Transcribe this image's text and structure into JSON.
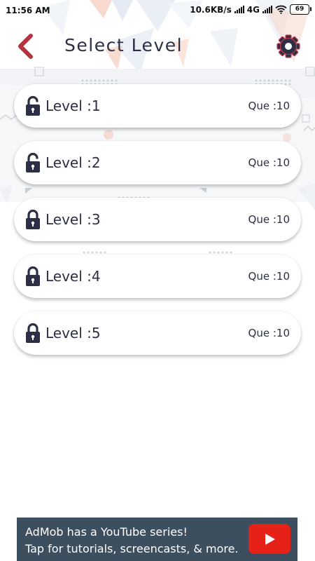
{
  "status_bar": {
    "time": "11:56 AM",
    "network_speed": "10.6KB/s",
    "network_type": "4G",
    "battery": "69"
  },
  "header": {
    "title": "Select Level",
    "back_icon": "chevron-left-icon",
    "settings_icon": "gear-icon"
  },
  "levels": [
    {
      "label": "Level :1",
      "questions": "Que :10",
      "icon": "unlocked-padlock-icon"
    },
    {
      "label": "Level :2",
      "questions": "Que :10",
      "icon": "unlocked-padlock-icon"
    },
    {
      "label": "Level :3",
      "questions": "Que :10",
      "icon": "locked-padlock-icon"
    },
    {
      "label": "Level :4",
      "questions": "Que :10",
      "icon": "locked-padlock-icon"
    },
    {
      "label": "Level :5",
      "questions": "Que :10",
      "icon": "locked-padlock-icon"
    }
  ],
  "ad_banner": {
    "line1": "AdMob has a YouTube series!",
    "line2": "Tap for tutorials, screencasts, & more.",
    "play_icon": "youtube-play-icon"
  },
  "colors": {
    "text_dark": "#2c2f45",
    "back_arrow": "#b5323f",
    "gear": "#2c2f45",
    "gear_outline": "#c23a48",
    "ad_background": "#3d4e5e",
    "youtube_red": "#e62117"
  }
}
